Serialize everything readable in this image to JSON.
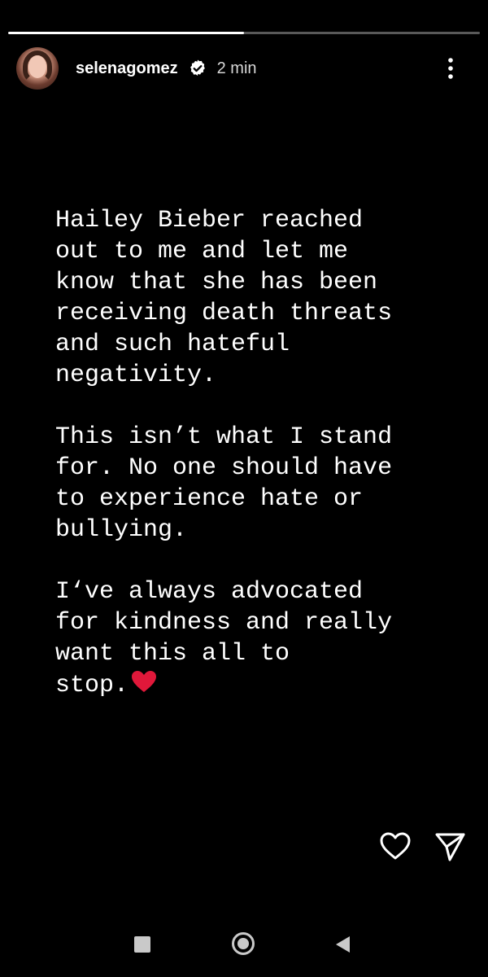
{
  "story": {
    "progress_fraction": 0.5,
    "username": "selenagomez",
    "time": "2 min",
    "verified": true,
    "paragraphs": [
      "Hailey Bieber reached\nout to me and let me\nknow that she has been\nreceiving death threats\nand such hateful\nnegativity.",
      "This isn’t what I stand\nfor. No one should have\nto experience hate or\nbullying.",
      "I‘ve always advocated\nfor kindness and really\nwant this all to\nstop."
    ],
    "end_emoji": "red-heart",
    "icons": {
      "avatar": "profile-photo",
      "verified": "verified-badge-icon",
      "more": "more-vertical-icon",
      "like": "heart-outline-icon",
      "share": "send-icon"
    }
  },
  "nav": {
    "icons": [
      "recents-square-icon",
      "home-circle-icon",
      "back-triangle-icon"
    ]
  },
  "colors": {
    "background": "#000000",
    "text": "#ffffff",
    "muted": "#d8d8d8",
    "heart": "#e0183a"
  }
}
